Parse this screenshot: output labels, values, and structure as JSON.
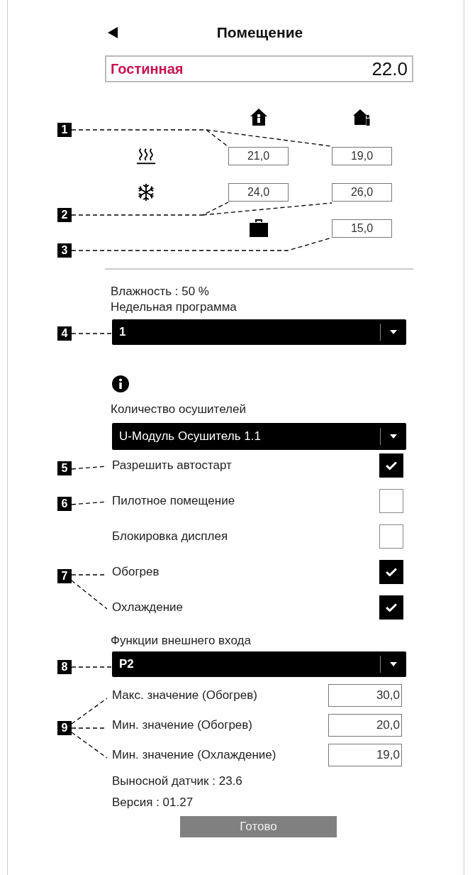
{
  "header": {
    "title": "Помещение"
  },
  "room": {
    "name": "Гостинная",
    "temperature": "22.0"
  },
  "setpoints": [
    {
      "kind": "heating",
      "comfort": "21,0",
      "economy": "19,0"
    },
    {
      "kind": "cooling",
      "comfort": "24,0",
      "economy": "26,0"
    },
    {
      "kind": "away",
      "economy": "15,0"
    }
  ],
  "humidity": "Влажность  : 50 %",
  "weekly_program": {
    "label": "Недельная программа",
    "value": "1"
  },
  "dehumidifiers": {
    "label": "Количество осушителей",
    "value": "U-Модуль Осушитель 1.1"
  },
  "options": [
    {
      "label": "Разрешить автостарт",
      "checked": true
    },
    {
      "label": "Пилотное помещение",
      "checked": false
    },
    {
      "label": "Блокировка дисплея",
      "checked": false
    },
    {
      "label": "Обогрев",
      "checked": true
    },
    {
      "label": "Охлаждение",
      "checked": true
    }
  ],
  "external_input": {
    "label": "Функции внешнего входа",
    "value": "P2"
  },
  "limits": [
    {
      "label": "Макс. значение (Обогрев)",
      "value": "30,0"
    },
    {
      "label": "Мин. значение (Обогрев)",
      "value": "20,0"
    },
    {
      "label": "Мин. значение (Охлаждение)",
      "value": "19,0"
    }
  ],
  "remote_sensor": "Выносной датчик : 23.6",
  "version": "Версия : 01.27",
  "done_button": "Готово",
  "callouts": [
    {
      "number": "1"
    },
    {
      "number": "2"
    },
    {
      "number": "3"
    },
    {
      "number": "4"
    },
    {
      "number": "5"
    },
    {
      "number": "6"
    },
    {
      "number": "7"
    },
    {
      "number": "8"
    },
    {
      "number": "9"
    }
  ]
}
